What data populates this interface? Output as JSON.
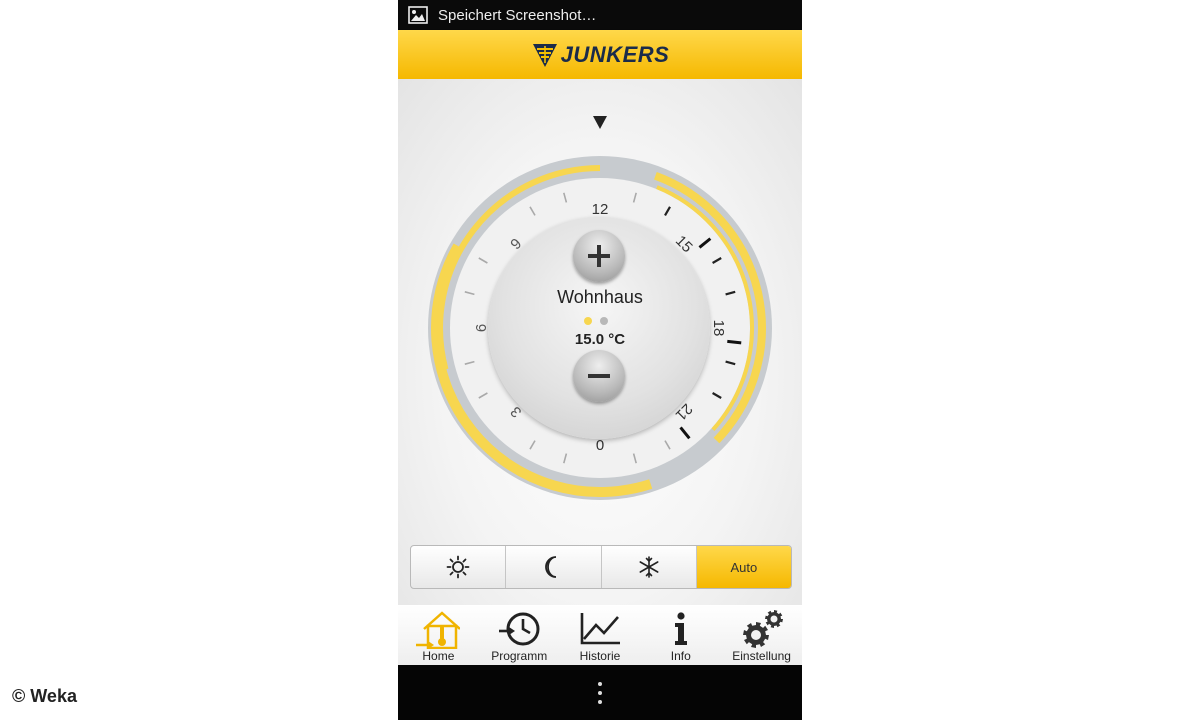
{
  "statusbar": {
    "text": "Speichert Screenshot…"
  },
  "brand": {
    "name": "JUNKERS",
    "color": "#1a2b4a",
    "accent": "#f5b800"
  },
  "dial": {
    "hour_labels": [
      "12",
      "15",
      "18",
      "21",
      "0",
      "3",
      "6",
      "9"
    ],
    "zone_name": "Wohnhaus",
    "temperature": "15.0 °C",
    "active_page_index": 0,
    "page_count": 2,
    "ring_color_active": "#f7d64f",
    "ring_color_inactive": "#bfc4c9"
  },
  "modes": {
    "items": [
      {
        "icon": "sun-icon",
        "label": ""
      },
      {
        "icon": "moon-icon",
        "label": ""
      },
      {
        "icon": "snowflake-icon",
        "label": ""
      },
      {
        "icon": "",
        "label": "Auto"
      }
    ],
    "active": "Auto"
  },
  "nav": {
    "items": [
      {
        "id": "home",
        "label": "Home",
        "icon": "house-thermometer-icon"
      },
      {
        "id": "programm",
        "label": "Programm",
        "icon": "clock-arrow-icon"
      },
      {
        "id": "historie",
        "label": "Historie",
        "icon": "line-chart-icon"
      },
      {
        "id": "info",
        "label": "Info",
        "icon": "info-icon"
      },
      {
        "id": "einstellung",
        "label": "Einstellung",
        "icon": "gears-icon"
      }
    ],
    "active": "Home"
  },
  "watermark": "© Weka"
}
